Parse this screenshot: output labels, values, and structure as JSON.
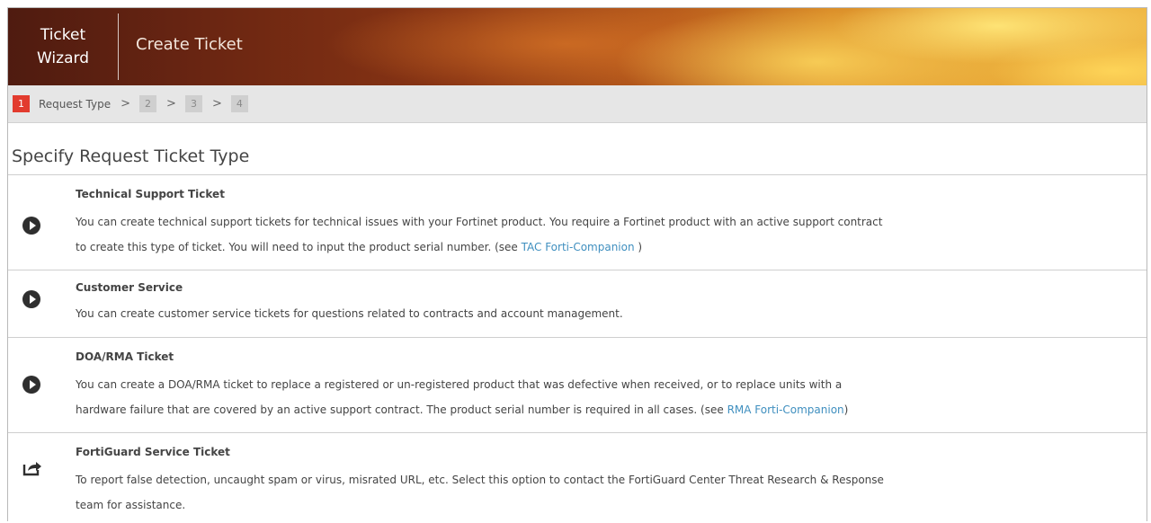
{
  "header": {
    "wizard_line1": "Ticket",
    "wizard_line2": "Wizard",
    "title": "Create Ticket"
  },
  "steps": {
    "active_number": "1",
    "active_label": "Request Type",
    "separator": ">",
    "others": [
      "2",
      "3",
      "4"
    ]
  },
  "section_title": "Specify Request Ticket Type",
  "options": [
    {
      "title": "Technical Support Ticket",
      "icon": "play-circle-icon",
      "desc_line1": "You can create technical support tickets for technical issues with your Fortinet product. You require a Fortinet product with an active support contract",
      "desc_line2": "to create this type of ticket. You will need to input the product serial number. (see",
      "link": "TAC Forti-Companion",
      "after": ")"
    },
    {
      "title": "Customer Service",
      "icon": "play-circle-icon",
      "desc_line1": "You can create customer service tickets for questions related to contracts and account management."
    },
    {
      "title": "DOA/RMA Ticket",
      "icon": "play-circle-icon",
      "desc_line1": "You can create a DOA/RMA ticket to replace a registered or un-registered product that was defective when received, or to replace units with a",
      "desc_line2": "hardware failure that are covered by an active support contract. The product serial number is required in all cases. (see",
      "link": "RMA Forti-Companion",
      "after": ")"
    },
    {
      "title": "FortiGuard Service Ticket",
      "icon": "share-icon",
      "desc_line1": "To report false detection, uncaught spam or virus, misrated URL, etc. Select this option to contact the FortiGuard Center Threat Research & Response",
      "desc_line2": "team for assistance."
    }
  ]
}
